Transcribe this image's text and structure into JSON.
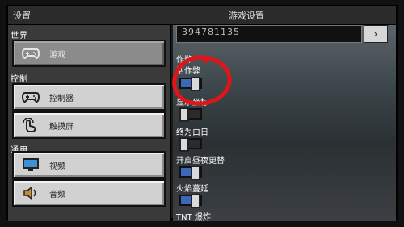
{
  "window": {
    "left_title": "设置",
    "center_title": "游戏设置"
  },
  "sidebar": {
    "sections": [
      {
        "label": "世界"
      },
      {
        "label": "控制"
      },
      {
        "label": "通用"
      }
    ],
    "items": [
      {
        "label": "游戏",
        "icon": "gamepad-icon",
        "active": true
      },
      {
        "label": "控制器",
        "icon": "gamepad-icon",
        "active": false
      },
      {
        "label": "触摸屏",
        "icon": "touch-icon",
        "active": false
      },
      {
        "label": "视频",
        "icon": "monitor-icon",
        "active": false
      },
      {
        "label": "音频",
        "icon": "speaker-icon",
        "active": false
      }
    ]
  },
  "main": {
    "seed_value": "394781135",
    "seed_button_glyph": "›",
    "options": [
      {
        "label": "作弊",
        "type": "heading"
      },
      {
        "label": "活作弊",
        "state": "on"
      },
      {
        "label": "显示坐标",
        "state": "off"
      },
      {
        "label": "终为白日",
        "state": "off"
      },
      {
        "label": "开启昼夜更替",
        "state": "on"
      },
      {
        "label": "火焰蔓延",
        "state": "on"
      },
      {
        "label": "TNT 爆炸",
        "type": "heading"
      }
    ]
  },
  "annotation": {
    "color": "#e0151a",
    "shape": "hand-drawn-circle"
  }
}
